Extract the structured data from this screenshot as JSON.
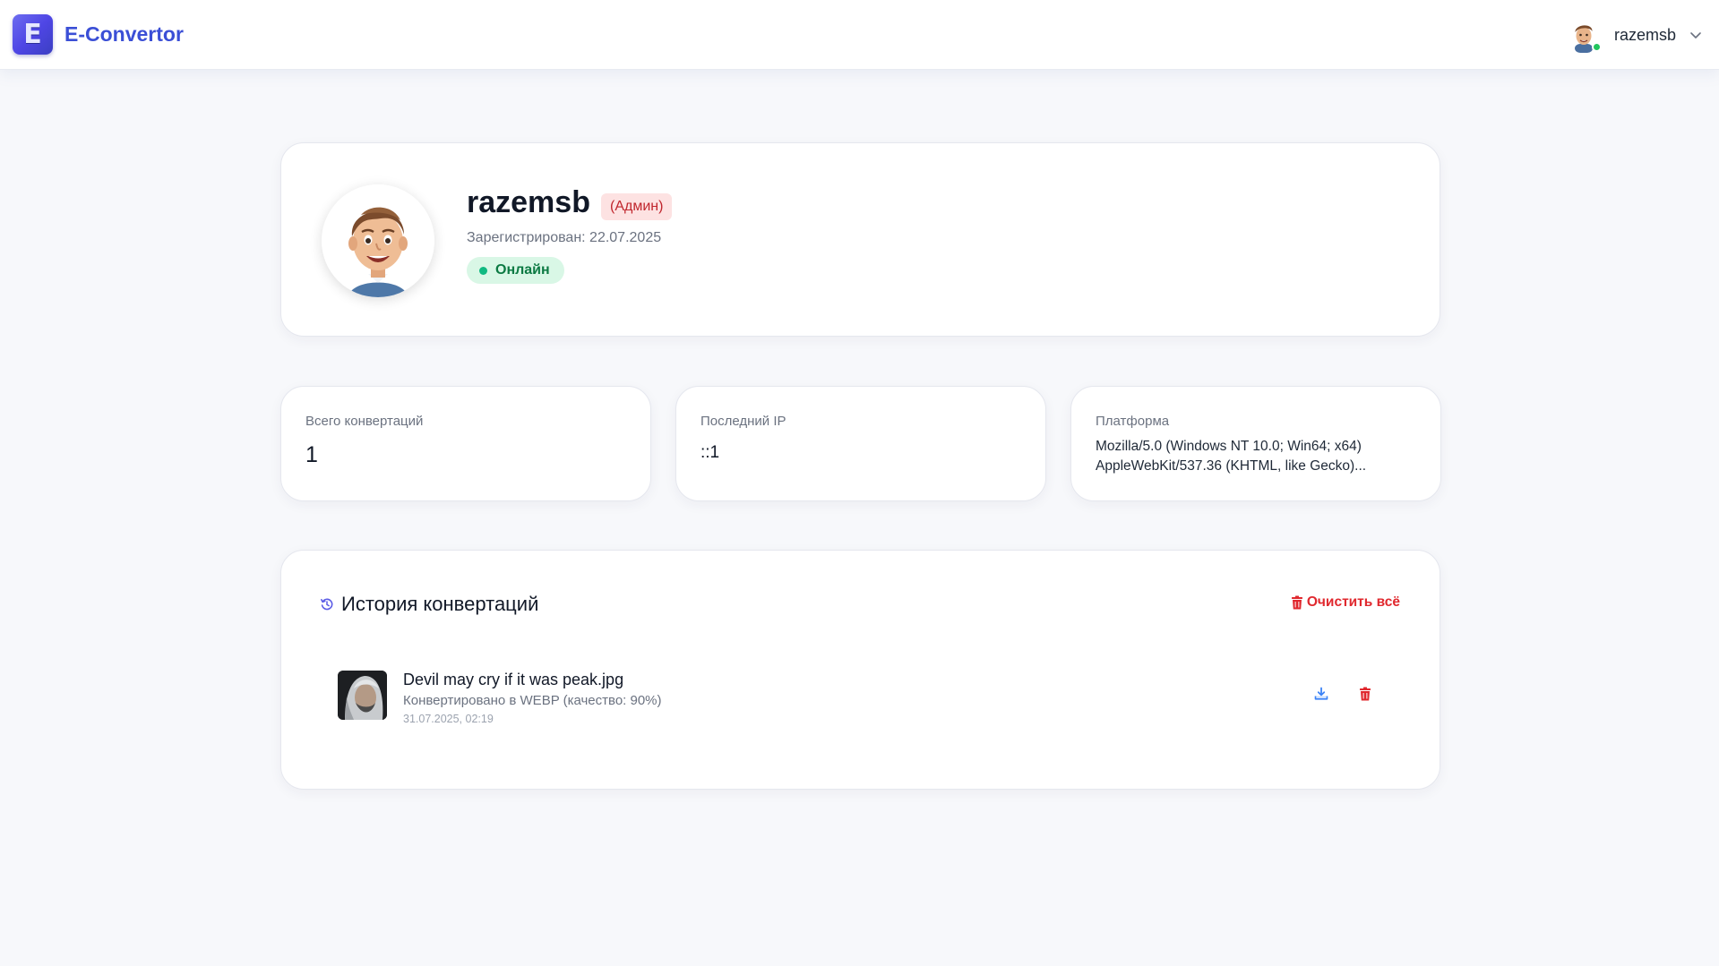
{
  "app": {
    "logo_letter": "E",
    "brand": "E-Convertor"
  },
  "header": {
    "user_name": "razemsb",
    "status_color": "#22c55e"
  },
  "profile": {
    "name": "razemsb",
    "role": "(Админ)",
    "registered": "Зарегистрирован: 22.07.2025",
    "status": "Онлайн"
  },
  "stats": [
    {
      "label": "Всего конвертаций",
      "value": "1"
    },
    {
      "label": "Последний IP",
      "value": "::1"
    },
    {
      "label": "Платформа",
      "value": "Mozilla/5.0 (Windows NT 10.0; Win64; x64) AppleWebKit/537.36 (KHTML, like Gecko)..."
    }
  ],
  "history": {
    "title": "История конвертаций",
    "clear_label": "Очистить всё",
    "items": [
      {
        "file": "Devil may cry if it was peak.jpg",
        "desc": "Конвертировано в WEBP (качество: 90%)",
        "date": "31.07.2025, 02:19"
      }
    ]
  },
  "colors": {
    "brand": "#3b4fd6",
    "danger": "#e0282e",
    "online": "#10b981",
    "download": "#3b82f6"
  }
}
